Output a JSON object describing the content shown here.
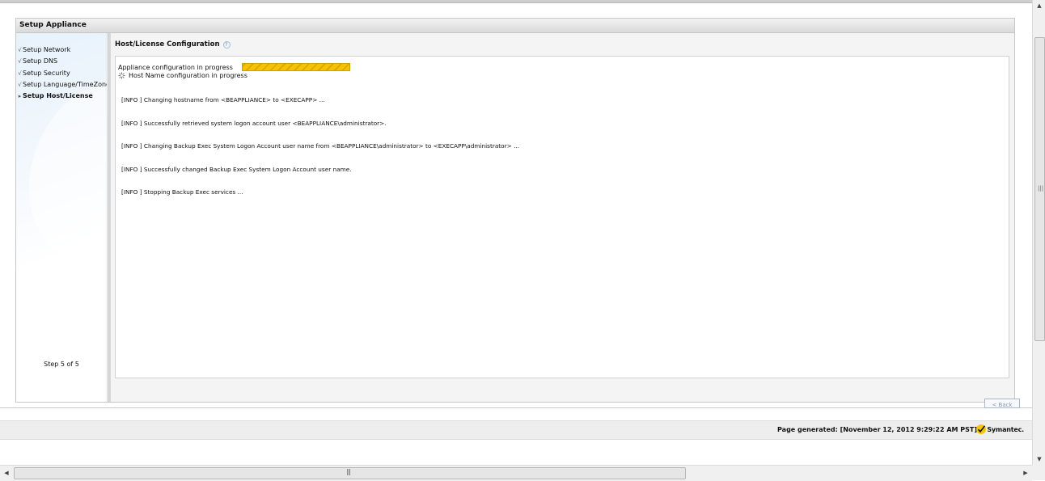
{
  "panel": {
    "title": "Setup Appliance"
  },
  "sidebar": {
    "items": [
      {
        "label": "Setup Network",
        "mark": "√"
      },
      {
        "label": "Setup DNS",
        "mark": "√"
      },
      {
        "label": "Setup Security",
        "mark": "√"
      },
      {
        "label": "Setup Language/TimeZone",
        "mark": "√"
      },
      {
        "label": "Setup Host/License",
        "mark": "▸"
      }
    ],
    "step": "Step 5 of 5"
  },
  "main": {
    "title": "Host/License Configuration",
    "help_icon": "?",
    "progress_label": "Appliance configuration in progress",
    "progress_fraction": 1.0,
    "sub_status": "Host Name configuration in progress",
    "log": [
      "[INFO ] Changing hostname from <BEAPPLIANCE> to <EXECAPP> ...",
      "[INFO ] Successfully retrieved system logon account user <BEAPPLIANCE\\administrator>.",
      "[INFO ] Changing Backup Exec System Logon Account user name from <BEAPPLIANCE\\administrator> to <EXECAPP\\administrator> ...",
      "[INFO ] Successfully changed Backup Exec System Logon Account user name.",
      "[INFO ] Stopping Backup Exec services ..."
    ],
    "back_label": "< Back"
  },
  "footer": {
    "page_generated": "Page generated: [November 12, 2012 9:29:22 AM PST]",
    "brand": "Symantec."
  },
  "scrollbars": {
    "grip": "|||",
    "grip_h": "|||"
  },
  "colors": {
    "progress": "#f5c400",
    "brand_check": "#f6c700",
    "sidebar_bg": "#e7f2fb"
  }
}
